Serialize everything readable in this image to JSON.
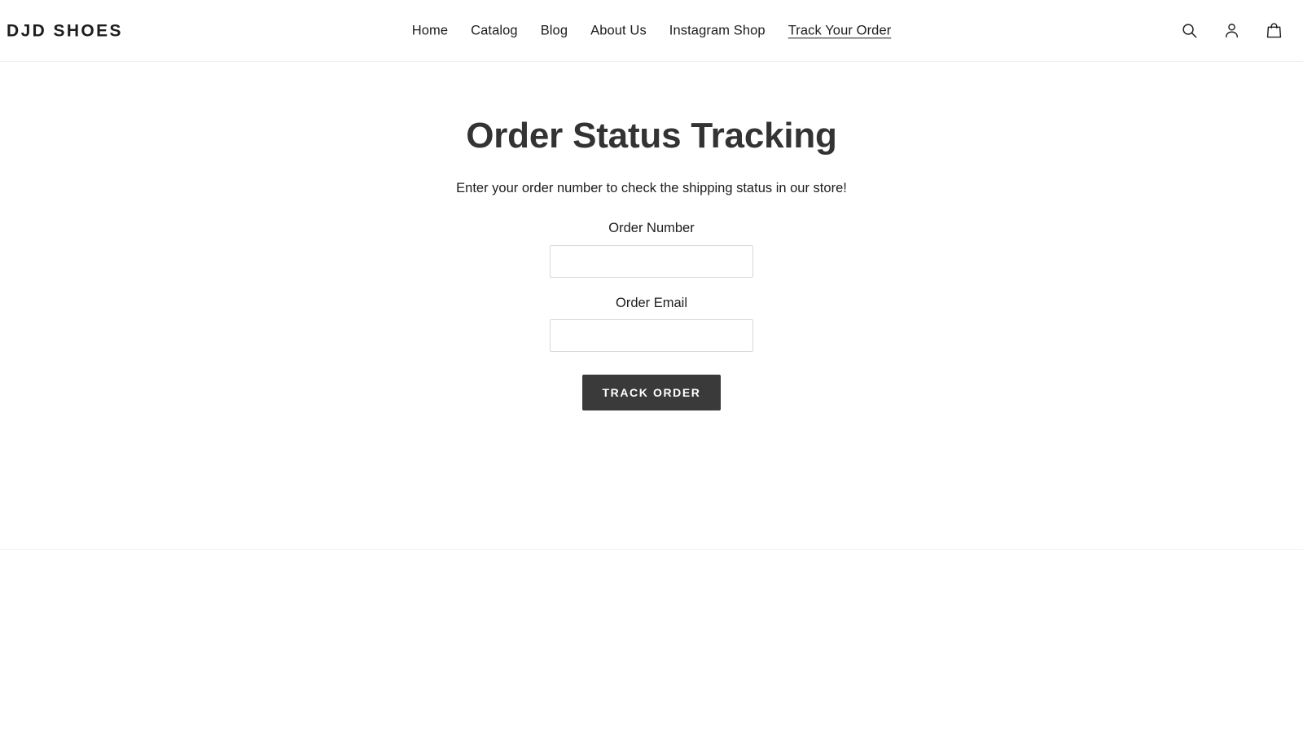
{
  "header": {
    "logo": "DJD SHOES",
    "nav": [
      {
        "label": "Home",
        "active": false
      },
      {
        "label": "Catalog",
        "active": false
      },
      {
        "label": "Blog",
        "active": false
      },
      {
        "label": "About Us",
        "active": false
      },
      {
        "label": "Instagram Shop",
        "active": false
      },
      {
        "label": "Track Your Order",
        "active": true
      }
    ],
    "icons": [
      {
        "name": "search-icon",
        "label": "Search"
      },
      {
        "name": "account-icon",
        "label": "Log in"
      },
      {
        "name": "cart-icon",
        "label": "Cart"
      }
    ]
  },
  "main": {
    "title": "Order Status Tracking",
    "subtitle": "Enter your order number to check the shipping status in our store!",
    "form": {
      "fields": [
        {
          "label": "Order Number",
          "value": "",
          "placeholder": ""
        },
        {
          "label": "Order Email",
          "value": "",
          "placeholder": ""
        }
      ],
      "submit_label": "TRACK ORDER"
    }
  },
  "colors": {
    "text": "#1c1d1d",
    "title": "#333333",
    "button_bg": "#3a3a3a",
    "button_text": "#ffffff",
    "input_border": "#d8d8d8",
    "divider": "#f0f0f0",
    "page_bg": "#ffffff"
  }
}
